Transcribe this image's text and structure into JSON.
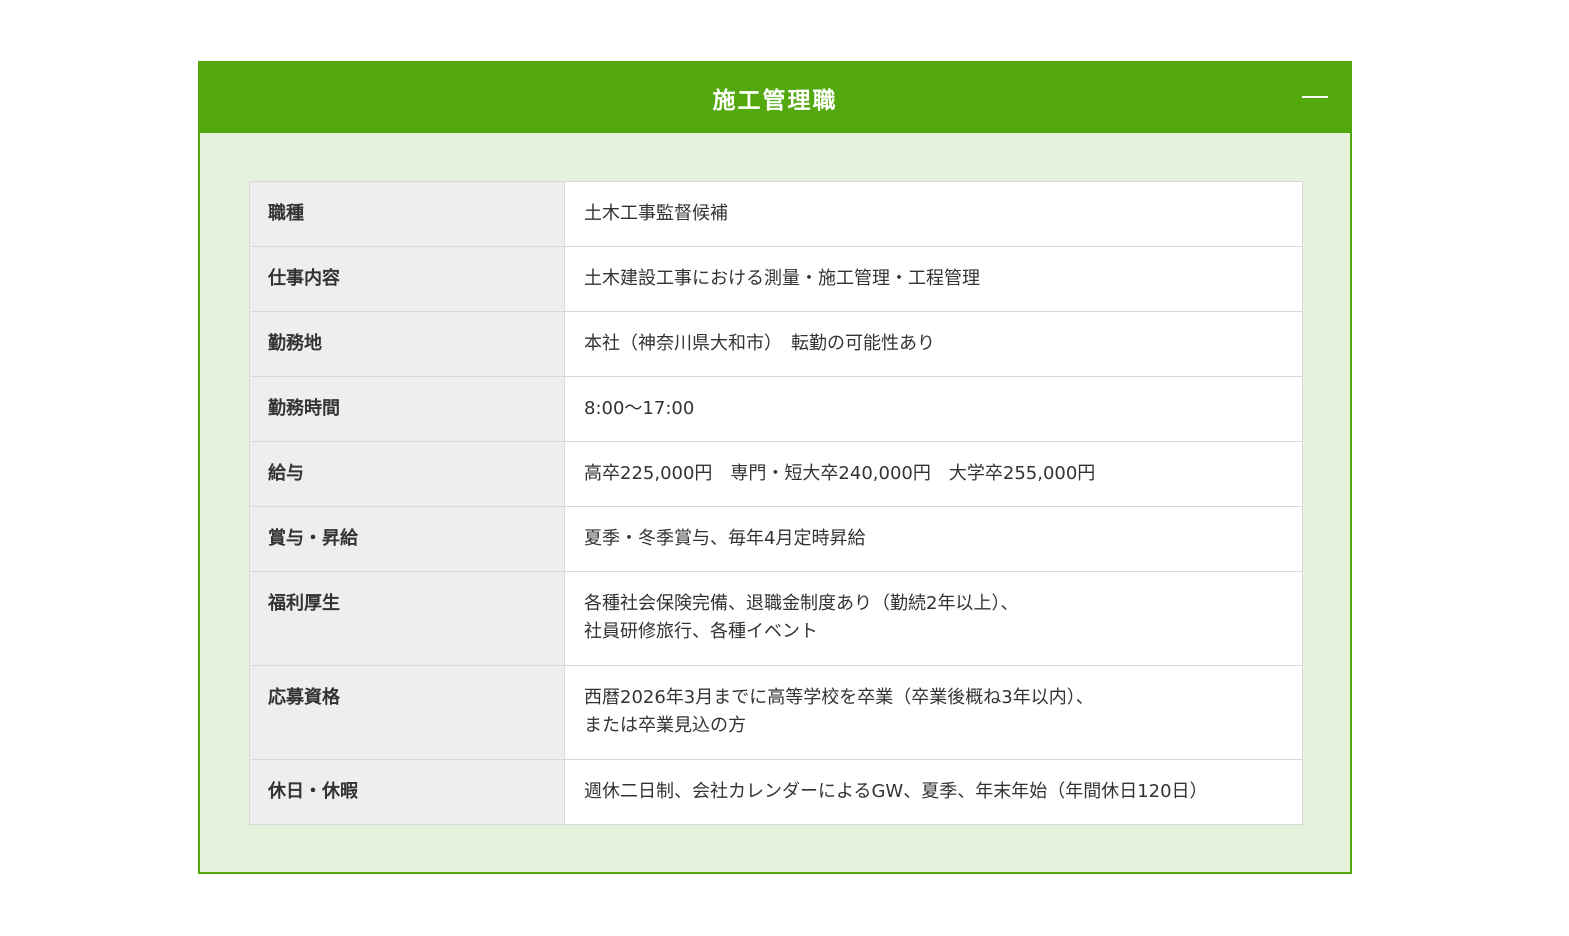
{
  "section": {
    "title": "施工管理職",
    "toggle_icon": "minus-icon"
  },
  "rows": [
    {
      "label": "職種",
      "value": "土木工事監督候補"
    },
    {
      "label": "仕事内容",
      "value": "土木建設工事における測量・施工管理・工程管理"
    },
    {
      "label": "勤務地",
      "value": "本社（神奈川県大和市）　転勤の可能性あり"
    },
    {
      "label": "勤務時間",
      "value": "8:00〜17:00"
    },
    {
      "label": "給与",
      "value": "高卒225,000円　専門・短大卒240,000円　大学卒255,000円"
    },
    {
      "label": "賞与・昇給",
      "value": "夏季・冬季賞与、毎年4月定時昇給"
    },
    {
      "label": "福利厚生",
      "value": "各種社会保険完備、退職金制度あり（勤続2年以上）、\n社員研修旅行、各種イベント"
    },
    {
      "label": "応募資格",
      "value": "西暦2026年3月までに高等学校を卒業（卒業後概ね3年以内）、\nまたは卒業見込の方"
    },
    {
      "label": "休日・休暇",
      "value": "週休二日制、会社カレンダーによるGW、夏季、年末年始（年間休日120日）"
    }
  ],
  "colors": {
    "accent": "#52a80c",
    "panel_bg": "#e5f3dc",
    "label_bg": "#eeeeee",
    "border": "#d9d9d9"
  }
}
